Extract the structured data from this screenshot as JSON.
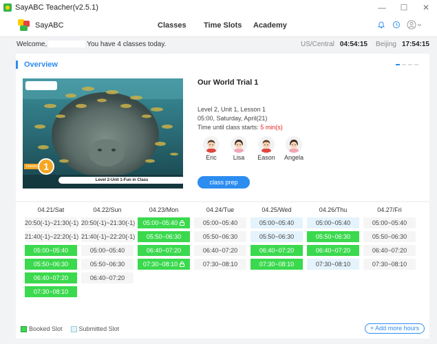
{
  "window": {
    "title": "SayABC Teacher(v2.5.1)",
    "controls": [
      "—",
      "☐",
      "✕"
    ]
  },
  "header": {
    "logo_text": "SayABC",
    "nav": [
      "Classes",
      "Time Slots",
      "Academy"
    ],
    "icons": [
      "bell-icon",
      "refresh-icon",
      "user-avatar-icon"
    ]
  },
  "welcome": {
    "greeting": "Welcome,",
    "classes_text": "You have 4 classes today.",
    "tz1_label": "US/Central",
    "tz1_time": "04:54:15",
    "tz2_label": "Beijing",
    "tz2_time": "17:54:15"
  },
  "overview": {
    "title": "Overview",
    "thumbnail_caption": "Level 2-Unit 1-Fun in Class",
    "lesson_tag": "Lesson",
    "lesson_number": "1",
    "class_title": "Our World Trial 1",
    "level_line": "Level 2, Unit 1, Lesson 1",
    "time_line": "05:00, Saturday, April(21)",
    "countdown_label": "Time until class starts:",
    "countdown_value": "5 min(s)",
    "students": [
      {
        "name": "Eric",
        "gender": "boy"
      },
      {
        "name": "Lisa",
        "gender": "girl"
      },
      {
        "name": "Eason",
        "gender": "boy"
      },
      {
        "name": "Angela",
        "gender": "girl"
      }
    ],
    "prep_button": "class prep"
  },
  "schedule": {
    "colors": {
      "booked": "#3bd94e",
      "submitted": "#e4f3fc",
      "available": "#f5f5f5"
    },
    "days": [
      {
        "label": "04.21/Sat",
        "slots": [
          {
            "t": "20:50(-1)~21:30(-1)",
            "s": "plain"
          },
          {
            "t": "21:40(-1)~22:20(-1)",
            "s": "plain"
          },
          {
            "t": "05:00~05:40",
            "s": "booked"
          },
          {
            "t": "05:50~06:30",
            "s": "booked"
          },
          {
            "t": "06:40~07:20",
            "s": "booked"
          },
          {
            "t": "07:30~08:10",
            "s": "booked"
          }
        ]
      },
      {
        "label": "04.22/Sun",
        "slots": [
          {
            "t": "20:50(-1)~21:30(-1)",
            "s": "plain"
          },
          {
            "t": "21:40(-1)~22:20(-1)",
            "s": "plain"
          },
          {
            "t": "05:00~05:40",
            "s": "plain"
          },
          {
            "t": "05:50~06:30",
            "s": "plain"
          },
          {
            "t": "06:40~07:20",
            "s": "plain"
          }
        ]
      },
      {
        "label": "04.23/Mon",
        "slots": [
          {
            "t": "05:00~05:40",
            "s": "booked",
            "lock": true
          },
          {
            "t": "05:50~06:30",
            "s": "booked"
          },
          {
            "t": "06:40~07:20",
            "s": "booked"
          },
          {
            "t": "07:30~08:10",
            "s": "booked",
            "lock": true
          }
        ]
      },
      {
        "label": "04.24/Tue",
        "slots": [
          {
            "t": "05:00~05:40",
            "s": "plain"
          },
          {
            "t": "05:50~06:30",
            "s": "plain"
          },
          {
            "t": "06:40~07:20",
            "s": "plain"
          },
          {
            "t": "07:30~08:10",
            "s": "plain"
          }
        ]
      },
      {
        "label": "04.25/Wed",
        "slots": [
          {
            "t": "05:00~05:40",
            "s": "submitted"
          },
          {
            "t": "05:50~06:30",
            "s": "submitted"
          },
          {
            "t": "06:40~07:20",
            "s": "booked"
          },
          {
            "t": "07:30~08:10",
            "s": "booked"
          }
        ]
      },
      {
        "label": "04.26/Thu",
        "slots": [
          {
            "t": "05:00~05:40",
            "s": "submitted"
          },
          {
            "t": "05:50~06:30",
            "s": "booked"
          },
          {
            "t": "06:40~07:20",
            "s": "booked"
          },
          {
            "t": "07:30~08:10",
            "s": "submitted"
          }
        ]
      },
      {
        "label": "04.27/Fri",
        "slots": [
          {
            "t": "05:00~05:40",
            "s": "plain"
          },
          {
            "t": "05:50~06:30",
            "s": "plain"
          },
          {
            "t": "06:40~07:20",
            "s": "plain"
          },
          {
            "t": "07:30~08:10",
            "s": "plain"
          }
        ]
      }
    ],
    "legend_booked": "Booked Slot",
    "legend_submitted": "Submitted Slot",
    "add_button": "+ Add more hours"
  }
}
